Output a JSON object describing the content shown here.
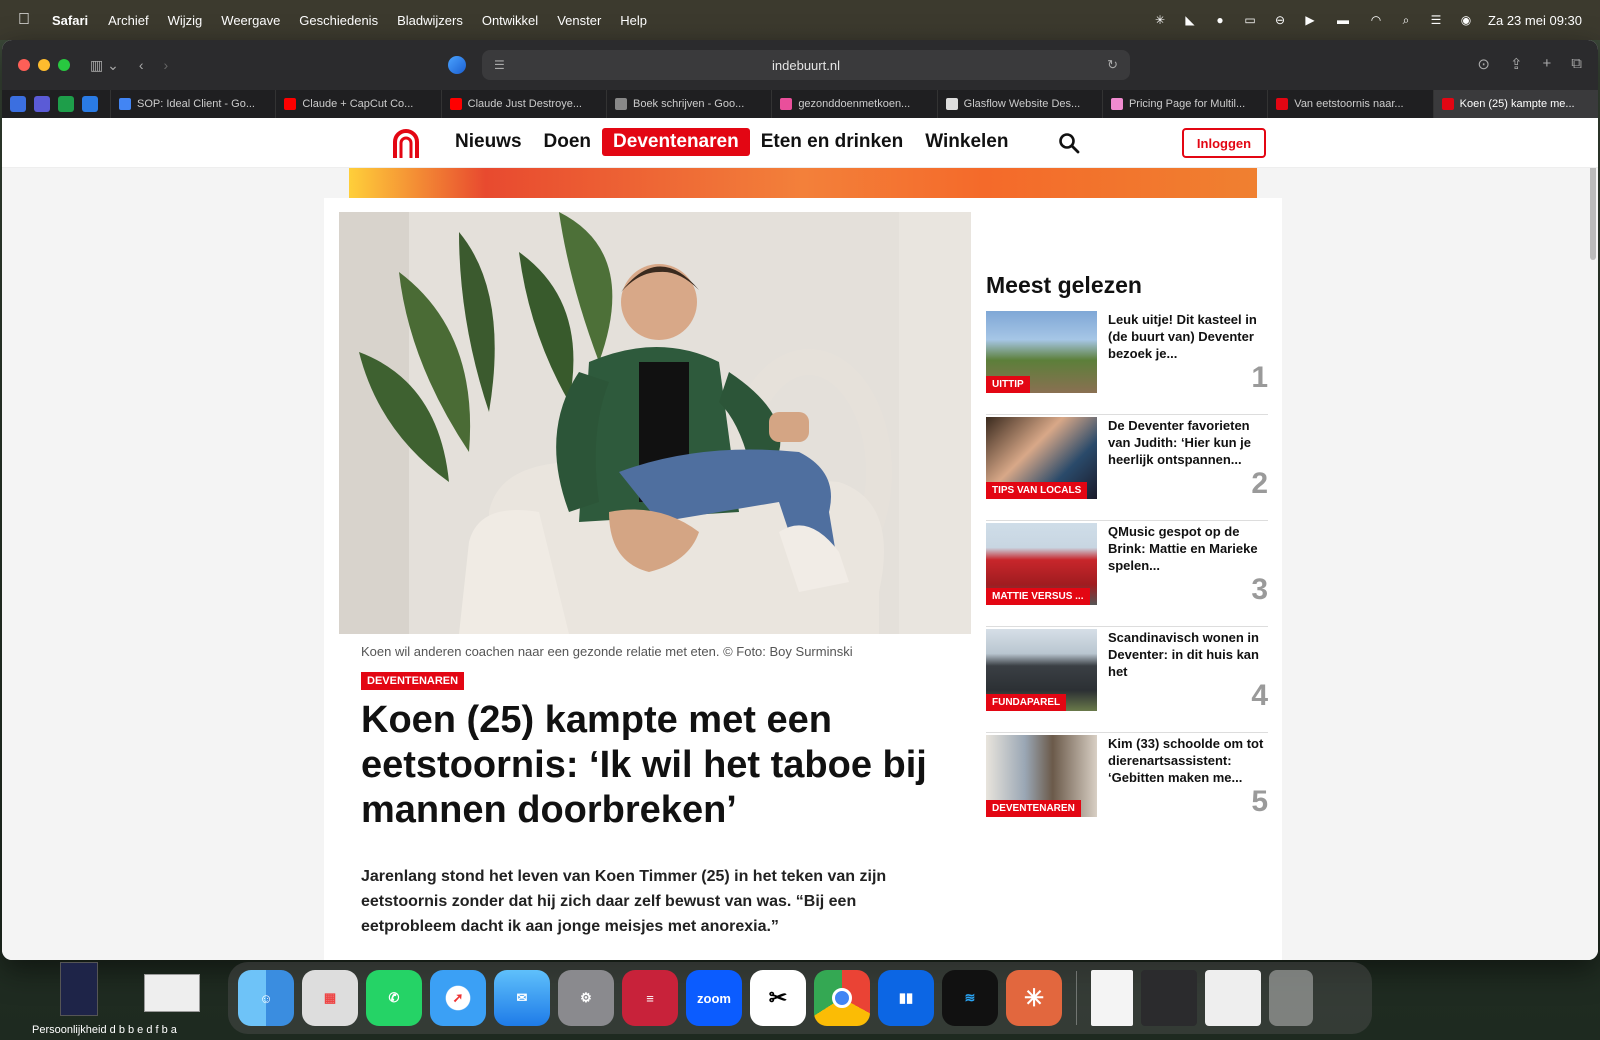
{
  "menubar": {
    "app_name": "Safari",
    "menus": [
      "Archief",
      "Wijzig",
      "Weergave",
      "Geschiedenis",
      "Bladwijzers",
      "Ontwikkel",
      "Venster",
      "Help"
    ],
    "datetime": "Za 23 mei  09:30"
  },
  "browser": {
    "url": "indebuurt.nl",
    "tabs": [
      {
        "title": "SOP: Ideal Client - Go...",
        "color": "#4285f4"
      },
      {
        "title": "Claude + CapCut Co...",
        "color": "#ff0000"
      },
      {
        "title": "Claude Just Destroye...",
        "color": "#ff0000"
      },
      {
        "title": "Boek schrijven - Goo...",
        "color": "#888888"
      },
      {
        "title": "gezonddoenmetkoen...",
        "color": "#e94f9b"
      },
      {
        "title": "Glasflow Website Des...",
        "color": "#dddddd"
      },
      {
        "title": "Pricing Page for Multil...",
        "color": "#f08bd0"
      },
      {
        "title": "Van eetstoornis naar...",
        "color": "#e30613"
      },
      {
        "title": "Koen (25) kampte me...",
        "color": "#e30613"
      }
    ]
  },
  "site": {
    "nav": [
      "Nieuws",
      "Doen",
      "Deventenaren",
      "Eten en drinken",
      "Winkelen"
    ],
    "active_nav": "Deventenaren",
    "login_label": "Inloggen",
    "accent": "#e30613"
  },
  "article": {
    "caption": "Koen wil anderen coachen naar een gezonde relatie met eten. © Foto: Boy Surminski",
    "category": "DEVENTENAREN",
    "headline": "Koen (25) kampte met een eetstoornis: ‘Ik wil het taboe bij mannen doorbreken’",
    "lead": "Jarenlang stond het leven van Koen Timmer (25) in het teken van zijn eetstoornis zonder dat hij zich daar zelf bewust van was. “Bij een eetprobleem dacht ik aan jonge meisjes met anorexia.”"
  },
  "most_read": {
    "title": "Meest gelezen",
    "items": [
      {
        "label": "UITTIP",
        "title": "Leuk uitje! Dit kasteel in (de buurt van) Deventer bezoek je...",
        "num": "1"
      },
      {
        "label": "TIPS VAN LOCALS",
        "title": "De Deventer favorieten van Judith: ‘Hier kun je heerlijk ontspannen...",
        "num": "2"
      },
      {
        "label": "MATTIE VERSUS ...",
        "title": "QMusic gespot op de Brink: Mattie en Marieke spelen...",
        "num": "3"
      },
      {
        "label": "FUNDAPAREL",
        "title": "Scandinavisch wonen in Deventer: in dit huis kan het",
        "num": "4"
      },
      {
        "label": "DEVENTENAREN",
        "title": "Kim (33) schoolde om tot dierenartsassistent: ‘Gebitten maken me...",
        "num": "5"
      }
    ]
  },
  "desktop": {
    "label": "Persoonlijkheid d b b e d f b a"
  },
  "dock": {
    "zoom_label": "zoom"
  }
}
